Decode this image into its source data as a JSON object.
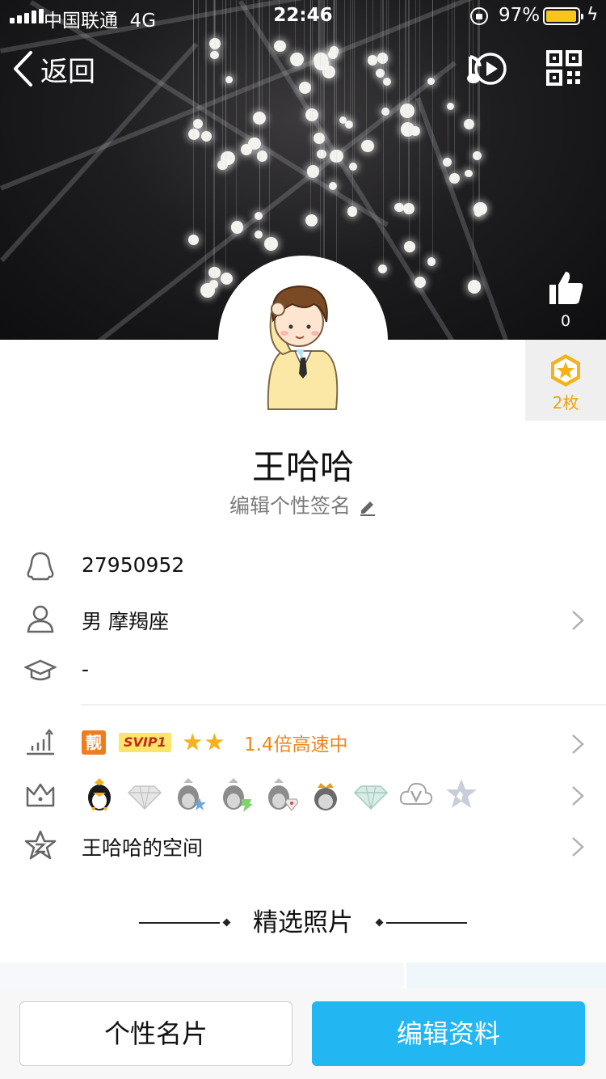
{
  "status_bar": {
    "carrier": "中国联通",
    "network": "4G",
    "time": "22:46",
    "battery_percent": "97%",
    "battery_level": 0.97,
    "battery_color": "#f9c51b"
  },
  "nav": {
    "back_label": "返回",
    "music_icon": "music-play-icon",
    "qr_icon": "qr-code-icon"
  },
  "cover": {
    "like_count": "0",
    "badge_label": "2枚"
  },
  "profile": {
    "name": "王哈哈",
    "signature_placeholder": "编辑个性签名"
  },
  "info_rows": {
    "qq_number": "27950952",
    "gender_constellation": "男 摩羯座",
    "education": "-",
    "space": "王哈哈的空间"
  },
  "vip": {
    "liang_label": "靓",
    "svip_label": "SVIP1",
    "star_count": 2,
    "speed_text": "1.4倍高速中"
  },
  "privileges": [
    "qq-penguin-icon",
    "diamond-icon",
    "blue-star-penguin-icon",
    "green-bolt-penguin-icon",
    "red-gem-penguin-icon",
    "crown-penguin-icon",
    "green-diamond-icon",
    "cloud-v-icon",
    "star-icon"
  ],
  "section": {
    "featured_photos": "精选照片"
  },
  "buttons": {
    "card": "个性名片",
    "edit": "编辑资料"
  },
  "colors": {
    "accent_blue": "#22b6f2",
    "orange": "#f0851e",
    "badge_gold": "#f2a20d"
  }
}
